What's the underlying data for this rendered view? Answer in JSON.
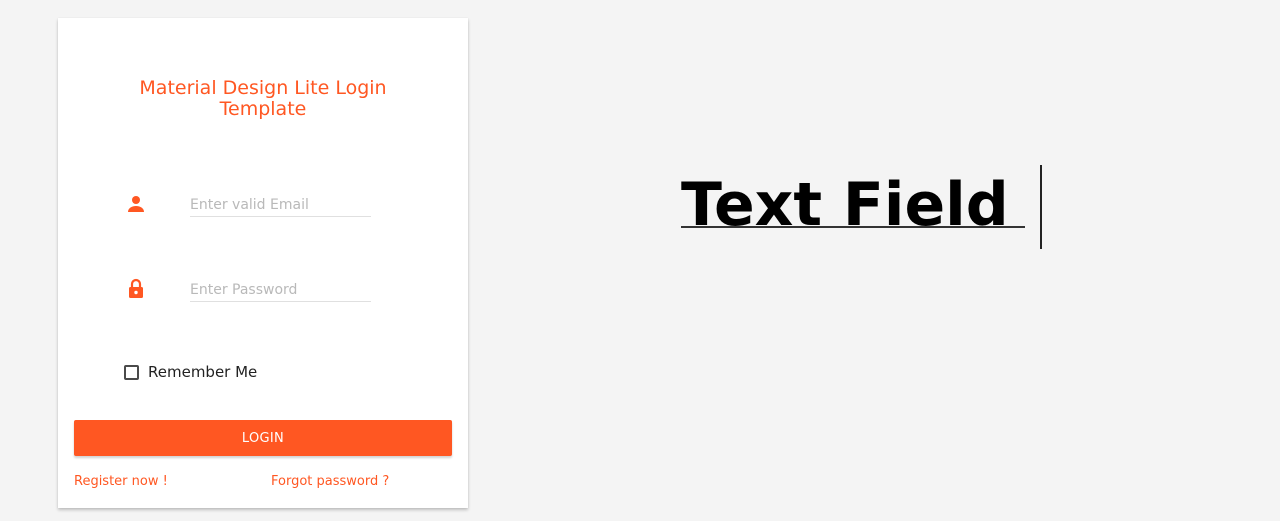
{
  "login_card": {
    "title": "Material Design Lite Login Template",
    "email": {
      "placeholder": "Enter valid Email",
      "icon": "person-icon"
    },
    "password": {
      "placeholder": "Enter Password",
      "icon": "lock-icon"
    },
    "remember_label": "Remember Me",
    "remember_checked": false,
    "login_label": "LOGIN",
    "register_link": "Register now !",
    "forgot_link": "Forgot password ?"
  },
  "banner": {
    "text": "Text Field"
  },
  "colors": {
    "accent": "#ff5722",
    "background": "#f4f4f4",
    "card": "#ffffff"
  }
}
